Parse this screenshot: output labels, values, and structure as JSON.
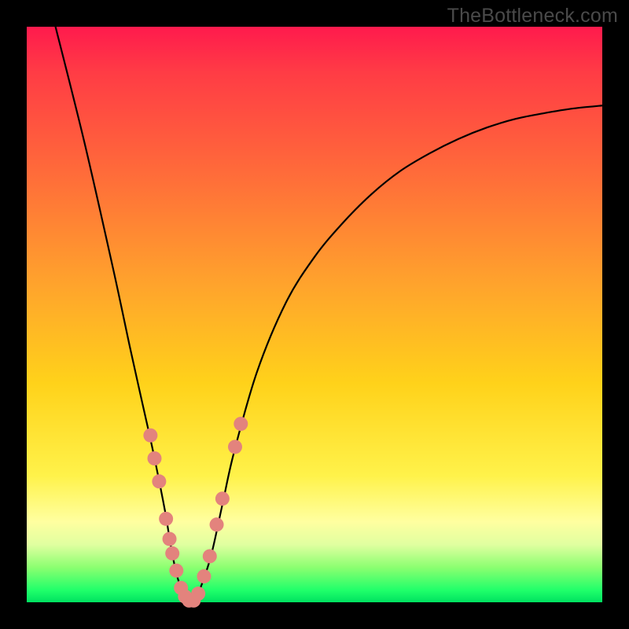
{
  "watermark": "TheBottleneck.com",
  "chart_data": {
    "type": "line",
    "title": "",
    "xlabel": "",
    "ylabel": "",
    "xlim": [
      0,
      100
    ],
    "ylim": [
      0,
      100
    ],
    "grid": false,
    "legend": false,
    "series": [
      {
        "name": "bottleneck-curve",
        "x": [
          5,
          10,
          15,
          18,
          20,
          22,
          24,
          25,
          26,
          27,
          28,
          29,
          30,
          32,
          34,
          36,
          40,
          45,
          50,
          55,
          60,
          65,
          70,
          75,
          80,
          85,
          90,
          95,
          100
        ],
        "y": [
          100,
          80,
          58,
          44,
          35,
          26,
          16,
          10,
          5,
          2,
          0,
          0,
          2,
          8,
          17,
          26,
          40,
          52,
          60,
          66,
          71,
          75,
          78,
          80.5,
          82.5,
          84,
          85,
          85.8,
          86.3
        ]
      }
    ],
    "markers": {
      "name": "highlighted-points",
      "color": "#e3837d",
      "points": [
        {
          "x": 21.5,
          "y": 29
        },
        {
          "x": 22.2,
          "y": 25
        },
        {
          "x": 23.0,
          "y": 21
        },
        {
          "x": 24.2,
          "y": 14.5
        },
        {
          "x": 24.8,
          "y": 11
        },
        {
          "x": 25.3,
          "y": 8.5
        },
        {
          "x": 26.0,
          "y": 5.5
        },
        {
          "x": 26.8,
          "y": 2.5
        },
        {
          "x": 27.5,
          "y": 1
        },
        {
          "x": 28.2,
          "y": 0.3
        },
        {
          "x": 29.0,
          "y": 0.3
        },
        {
          "x": 29.8,
          "y": 1.5
        },
        {
          "x": 30.8,
          "y": 4.5
        },
        {
          "x": 31.8,
          "y": 8
        },
        {
          "x": 33.0,
          "y": 13.5
        },
        {
          "x": 34.0,
          "y": 18
        },
        {
          "x": 36.2,
          "y": 27
        },
        {
          "x": 37.2,
          "y": 31
        }
      ]
    },
    "gradient_stops": [
      {
        "pos": 0.0,
        "color": "#ff1a4d"
      },
      {
        "pos": 0.25,
        "color": "#ff6a3a"
      },
      {
        "pos": 0.45,
        "color": "#ffa42c"
      },
      {
        "pos": 0.62,
        "color": "#ffd21a"
      },
      {
        "pos": 0.86,
        "color": "#ffffa0"
      },
      {
        "pos": 1.0,
        "color": "#00e060"
      }
    ]
  }
}
